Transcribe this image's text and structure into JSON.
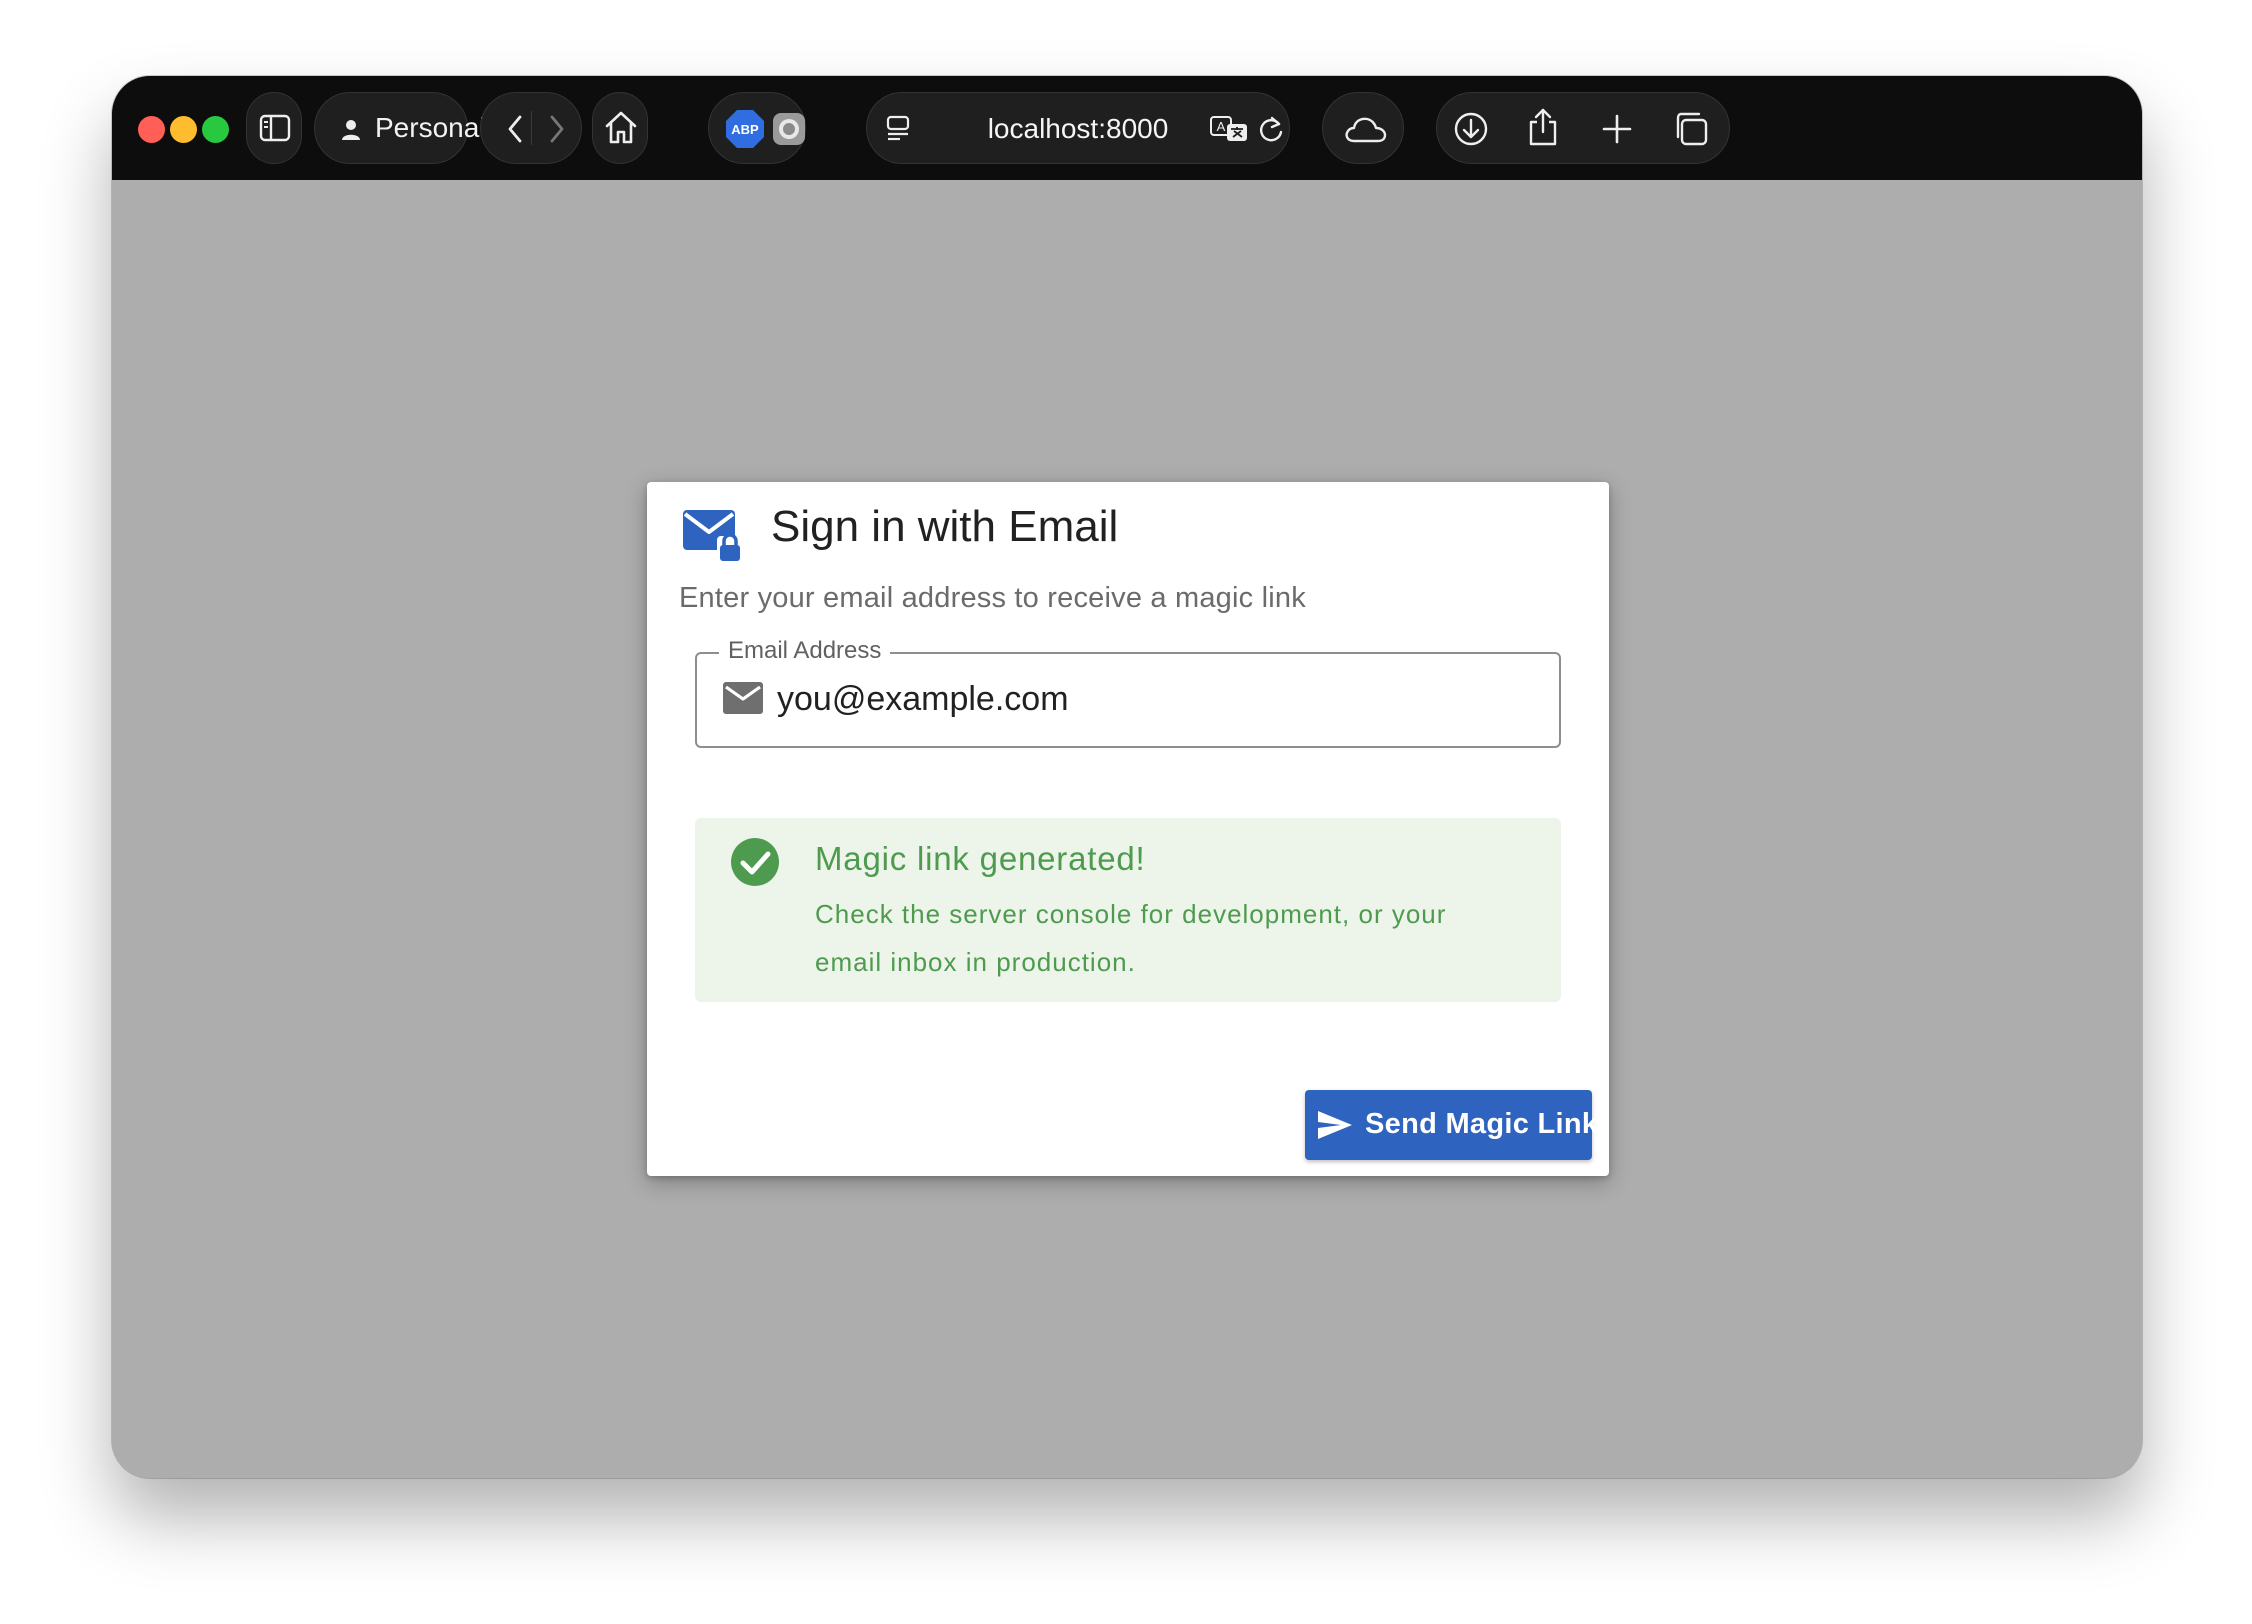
{
  "browser": {
    "profile_label": "Personal",
    "address": "localhost:8000",
    "traffic_lights": {
      "close": "#ff5f57",
      "minimize": "#febc2e",
      "zoom": "#28c840"
    },
    "extensions": {
      "adblock_label": "ABP"
    },
    "icons": [
      "sidebar-icon",
      "person-icon",
      "chevron-down-icon",
      "back-icon",
      "forward-icon",
      "home-icon",
      "adblock-icon",
      "extension-icon",
      "reader-icon",
      "translate-icon",
      "reload-icon",
      "cloud-icon",
      "download-icon",
      "share-icon",
      "new-tab-icon",
      "tabs-overview-icon"
    ]
  },
  "signin": {
    "title": "Sign in with Email",
    "subtitle": "Enter your email address to receive a magic link",
    "email_label": "Email Address",
    "email_value": "you@example.com",
    "alert_title": "Magic link generated!",
    "alert_body": "Check the server console for development, or your email inbox in production.",
    "send_label": "Send Magic Link"
  },
  "colors": {
    "accent": "#2f63c0",
    "success": "#4e9b50",
    "success_bg": "#edf4e9",
    "page_bg": "#adadad"
  }
}
